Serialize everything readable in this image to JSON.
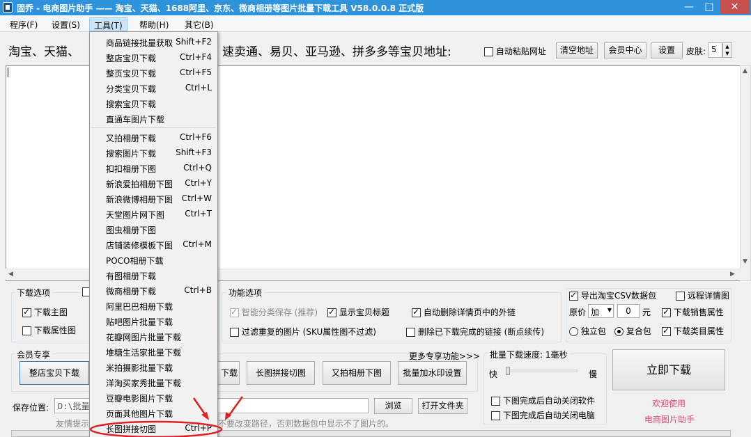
{
  "window": {
    "title": "固乔 - 电商图片助手 —— 淘宝、天猫、1688阿里、京东、微商相册等图片批量下载工具 V58.0.0.8 正式版",
    "minimize": "—",
    "maximize": "□",
    "close": "✕"
  },
  "menubar": {
    "items": [
      {
        "label": "程序(F)"
      },
      {
        "label": "设置(S)"
      },
      {
        "label": "工具(T)"
      },
      {
        "label": "帮助(H)"
      },
      {
        "label": "其它(B)"
      }
    ]
  },
  "url_section": {
    "label_left": "淘宝、天猫、",
    "label_right": "速卖通、易贝、亚马逊、拼多多等宝贝地址:",
    "auto_paste_label": "自动粘贴网址",
    "clear_button": "清空地址",
    "member_button": "会员中心",
    "settings_button": "设置",
    "skin_label": "皮肤:",
    "skin_value": "5",
    "text_value": ""
  },
  "download_options": {
    "title": "下载选项",
    "main_image": "下载主图",
    "attr_image": "下载属性图"
  },
  "function_options": {
    "title": "功能选项",
    "smart_classify": "智能分类保存 (推荐)",
    "show_title": "显示宝贝标题",
    "auto_delete_links": "自动删除详情页中的外链",
    "filter_duplicates": "过滤重复的图片 (SKU属性图不过滤)",
    "delete_completed": "删除已下载完成的链接 (断点续传)"
  },
  "csv_options": {
    "export_csv": "导出淘宝CSV数据包",
    "remote_detail": "远程详情图",
    "price_label": "原价",
    "price_op": "加",
    "price_value": "0",
    "price_unit": "元",
    "sales_attr": "下载销售属性",
    "standalone": "独立包",
    "composite": "复合包",
    "category_attr": "下载类目属性"
  },
  "member_section": {
    "title": "会员专享",
    "more": "更多专享功能>>>",
    "buttons": [
      {
        "label": "整店宝贝下载"
      },
      {
        "label": "下载"
      },
      {
        "label": "长图拼接切图"
      },
      {
        "label": "又拍相册下图"
      },
      {
        "label": "批量加水印设置"
      }
    ]
  },
  "speed_section": {
    "title": "批量下载速度: 1毫秒",
    "fast": "快",
    "slow": "慢",
    "speed_fraction": 0.0,
    "close_software": "下图完成后自动关闭软件",
    "shutdown_pc": "下图完成后自动关闭电脑"
  },
  "download_now": {
    "label": "立即下载",
    "welcome": "欢迎使用",
    "app_name": "电商图片助手"
  },
  "save_section": {
    "label": "保存位置:",
    "path": "D:\\批量!",
    "browse": "浏览",
    "open_folder": "打开文件夹",
    "hint_left": "友情提示",
    "hint_right": "不要改变路径，否则数据包中显示不了图片的。"
  },
  "tools_menu": {
    "items": [
      {
        "label": "商品链接批量获取",
        "shortcut": "Shift+F2"
      },
      {
        "label": "整店宝贝下载",
        "shortcut": "Ctrl+F4"
      },
      {
        "label": "整页宝贝下载",
        "shortcut": "Ctrl+F5"
      },
      {
        "label": "分类宝贝下载",
        "shortcut": "Ctrl+L"
      },
      {
        "label": "搜索宝贝下载",
        "shortcut": ""
      },
      {
        "label": "直通车图片下载",
        "shortcut": ""
      },
      {
        "label": "又拍相册下载",
        "shortcut": "Ctrl+F6"
      },
      {
        "label": "搜索图片下载",
        "shortcut": "Shift+F3"
      },
      {
        "label": "扣扣相册下图",
        "shortcut": "Ctrl+Q"
      },
      {
        "label": "新浪爱拍相册下图",
        "shortcut": "Ctrl+Y"
      },
      {
        "label": "新浪微博相册下图",
        "shortcut": "Ctrl+W"
      },
      {
        "label": "天堂图片网下图",
        "shortcut": "Ctrl+T"
      },
      {
        "label": "图虫相册下图",
        "shortcut": ""
      },
      {
        "label": "店铺装修模板下图",
        "shortcut": "Ctrl+M"
      },
      {
        "label": "POCO相册下载",
        "shortcut": ""
      },
      {
        "label": "有图相册下载",
        "shortcut": ""
      },
      {
        "label": "微商相册下载",
        "shortcut": "Ctrl+B"
      },
      {
        "label": "阿里巴巴相册下载",
        "shortcut": ""
      },
      {
        "label": "贴吧图片批量下载",
        "shortcut": ""
      },
      {
        "label": "花瓣网图片批量下载",
        "shortcut": ""
      },
      {
        "label": "堆糖生活家批量下载",
        "shortcut": ""
      },
      {
        "label": "米拍摄影批量下载",
        "shortcut": ""
      },
      {
        "label": "洋淘买家秀批量下载",
        "shortcut": ""
      },
      {
        "label": "豆瓣电影图片下载",
        "shortcut": ""
      },
      {
        "label": "页面其他图片下载",
        "shortcut": ""
      },
      {
        "label": "长图拼接切图",
        "shortcut": "Ctrl+P"
      }
    ]
  },
  "colors": {
    "titlebar": "#2f93dc",
    "annotation": "#e02020"
  }
}
